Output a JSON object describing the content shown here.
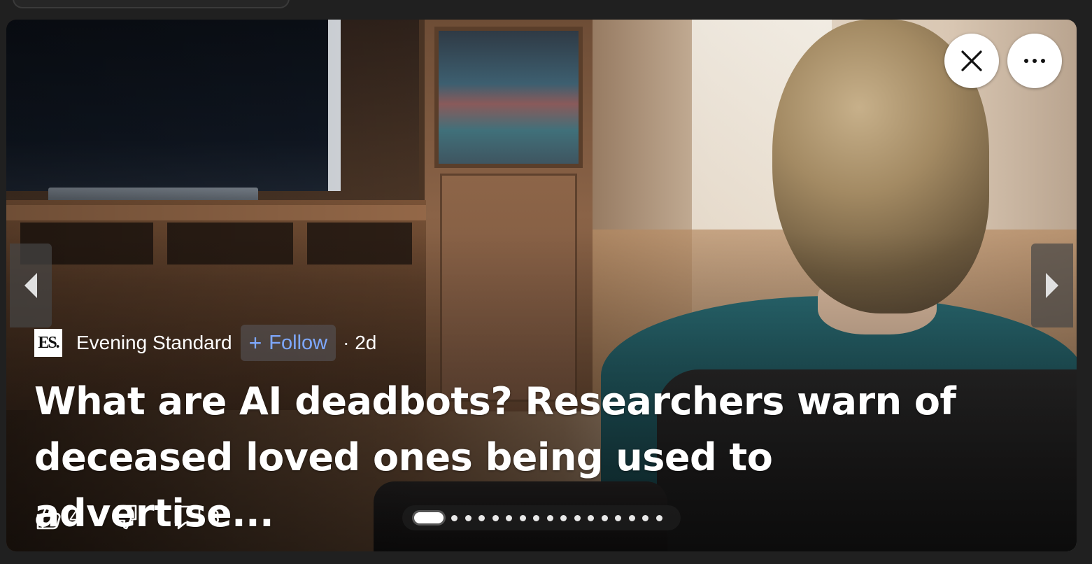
{
  "article": {
    "source_name": "Evening Standard",
    "source_logo_text": "ES.",
    "follow_label": "Follow",
    "age": "· 2d",
    "headline": "What are AI deadbots? Researchers warn of deceased loved ones being used to advertise..."
  },
  "engagement": {
    "likes": "4",
    "comments": "3"
  },
  "pager": {
    "total_slides": 17,
    "active_index": 0
  },
  "icons": {
    "close": "close-icon",
    "more": "more-horizontal-icon",
    "prev": "chevron-left-icon",
    "next": "chevron-right-icon",
    "like": "thumbs-up-icon",
    "dislike": "thumbs-down-icon",
    "comment": "comment-icon",
    "follow": "plus-icon"
  },
  "colors": {
    "follow_text": "#7ea8ff",
    "page_background": "#202020"
  }
}
